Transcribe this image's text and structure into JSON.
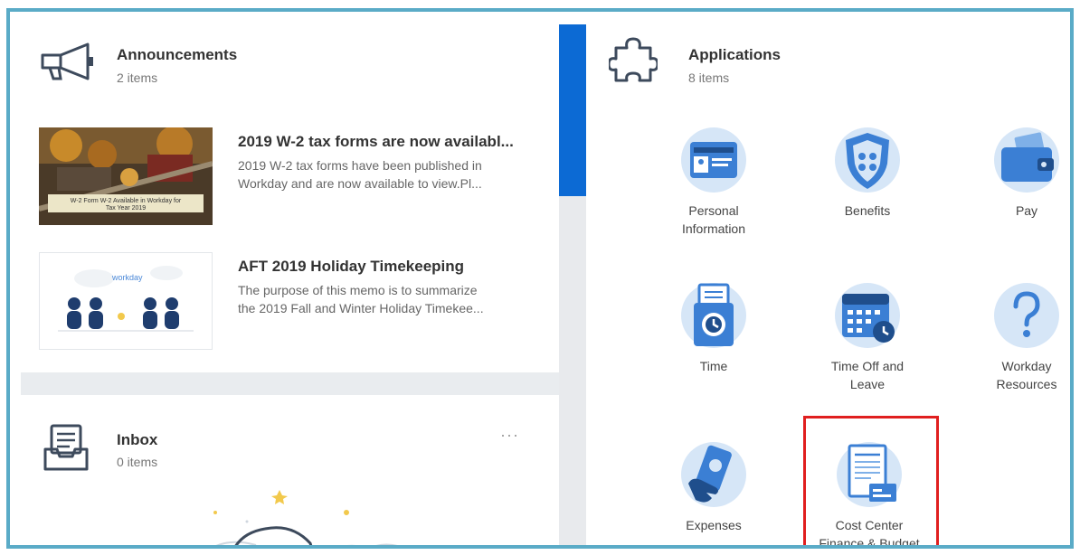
{
  "announcements": {
    "title": "Announcements",
    "count": "2 items",
    "items": [
      {
        "title": "2019 W-2 tax forms are now availabl...",
        "desc_line1": "2019 W-2 tax forms have been published in",
        "desc_line2": "Workday and are now available to view.Pl...",
        "thumb_caption_1": "W-2 Form W-2 Available in Workday for",
        "thumb_caption_2": "Tax Year 2019"
      },
      {
        "title": "AFT 2019 Holiday Timekeeping",
        "desc_line1": "The purpose of this memo is to summarize",
        "desc_line2": "the 2019 Fall and Winter Holiday Timekee...",
        "thumb_caption_1": "workday"
      }
    ]
  },
  "inbox": {
    "title": "Inbox",
    "count": "0 items",
    "more_label": "···"
  },
  "applications": {
    "title": "Applications",
    "count": "8 items",
    "apps": [
      {
        "label1": "Personal",
        "label2": "Information",
        "icon": "id-card-icon"
      },
      {
        "label1": "Benefits",
        "label2": "",
        "icon": "shield-icon"
      },
      {
        "label1": "Pay",
        "label2": "",
        "icon": "wallet-icon"
      },
      {
        "label1": "Time",
        "label2": "",
        "icon": "time-clock-icon"
      },
      {
        "label1": "Time Off and",
        "label2": "Leave",
        "icon": "calendar-icon"
      },
      {
        "label1": "Workday",
        "label2": "Resources",
        "icon": "question-icon"
      },
      {
        "label1": "Expenses",
        "label2": "",
        "icon": "hand-card-icon"
      },
      {
        "label1": "Cost Center",
        "label2": "Finance & Budget",
        "icon": "document-report-icon"
      }
    ]
  },
  "colors": {
    "frame_border": "#5aabc7",
    "accent_blue": "#0c6ad4",
    "icon_blue": "#3b7fd4",
    "icon_bg": "#d6e6f7",
    "highlight_red": "#e01f1f"
  }
}
